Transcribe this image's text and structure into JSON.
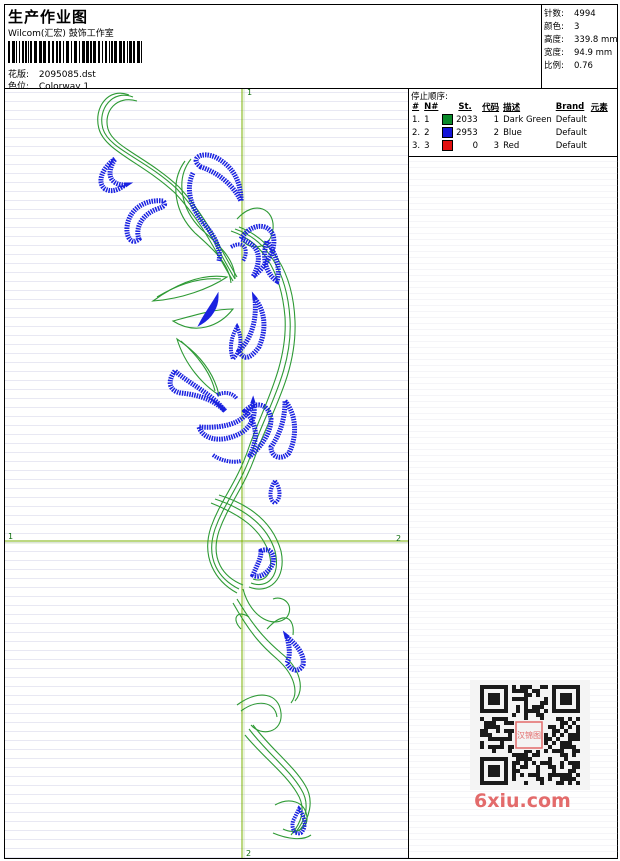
{
  "header": {
    "title": "生产作业图",
    "company": "Wilcom(汇宏) 鼓饰工作室",
    "design_label": "花版:",
    "design_file": "2095085.dst",
    "colorway_label": "色位:",
    "colorway": "Colorway 1"
  },
  "stats": [
    {
      "label": "针数:",
      "value": "4994"
    },
    {
      "label": "颜色:",
      "value": "3"
    },
    {
      "label": "高度:",
      "value": "339.8 mm"
    },
    {
      "label": "宽度:",
      "value": "94.9 mm"
    },
    {
      "label": "比例:",
      "value": "0.76"
    }
  ],
  "stop_sequence": {
    "title": "停止顺序:",
    "headers": [
      "#",
      "N#",
      "St.",
      "代码",
      "描述",
      "Brand",
      "元素"
    ],
    "rows": [
      {
        "index": "1.",
        "n": "1",
        "color": "#0a8a2a",
        "stitches": "2033",
        "code": "1",
        "description": "Dark Green",
        "brand": "Default",
        "element": ""
      },
      {
        "index": "2.",
        "n": "2",
        "color": "#1414d8",
        "stitches": "2953",
        "code": "2",
        "description": "Blue",
        "brand": "Default",
        "element": ""
      },
      {
        "index": "3.",
        "n": "3",
        "color": "#e01010",
        "stitches": "0",
        "code": "3",
        "description": "Red",
        "brand": "Default",
        "element": ""
      }
    ]
  },
  "axes": {
    "top": "1",
    "left": "1",
    "right": "2",
    "bottom": "2"
  },
  "colors": {
    "green_thread": "#2e9a35",
    "blue_thread": "#1a22e0",
    "axis_line": "#7ab000",
    "watermark": "#e36b6b"
  },
  "watermark": {
    "site": "6xiu.com",
    "seal_text": "汉锦图"
  }
}
